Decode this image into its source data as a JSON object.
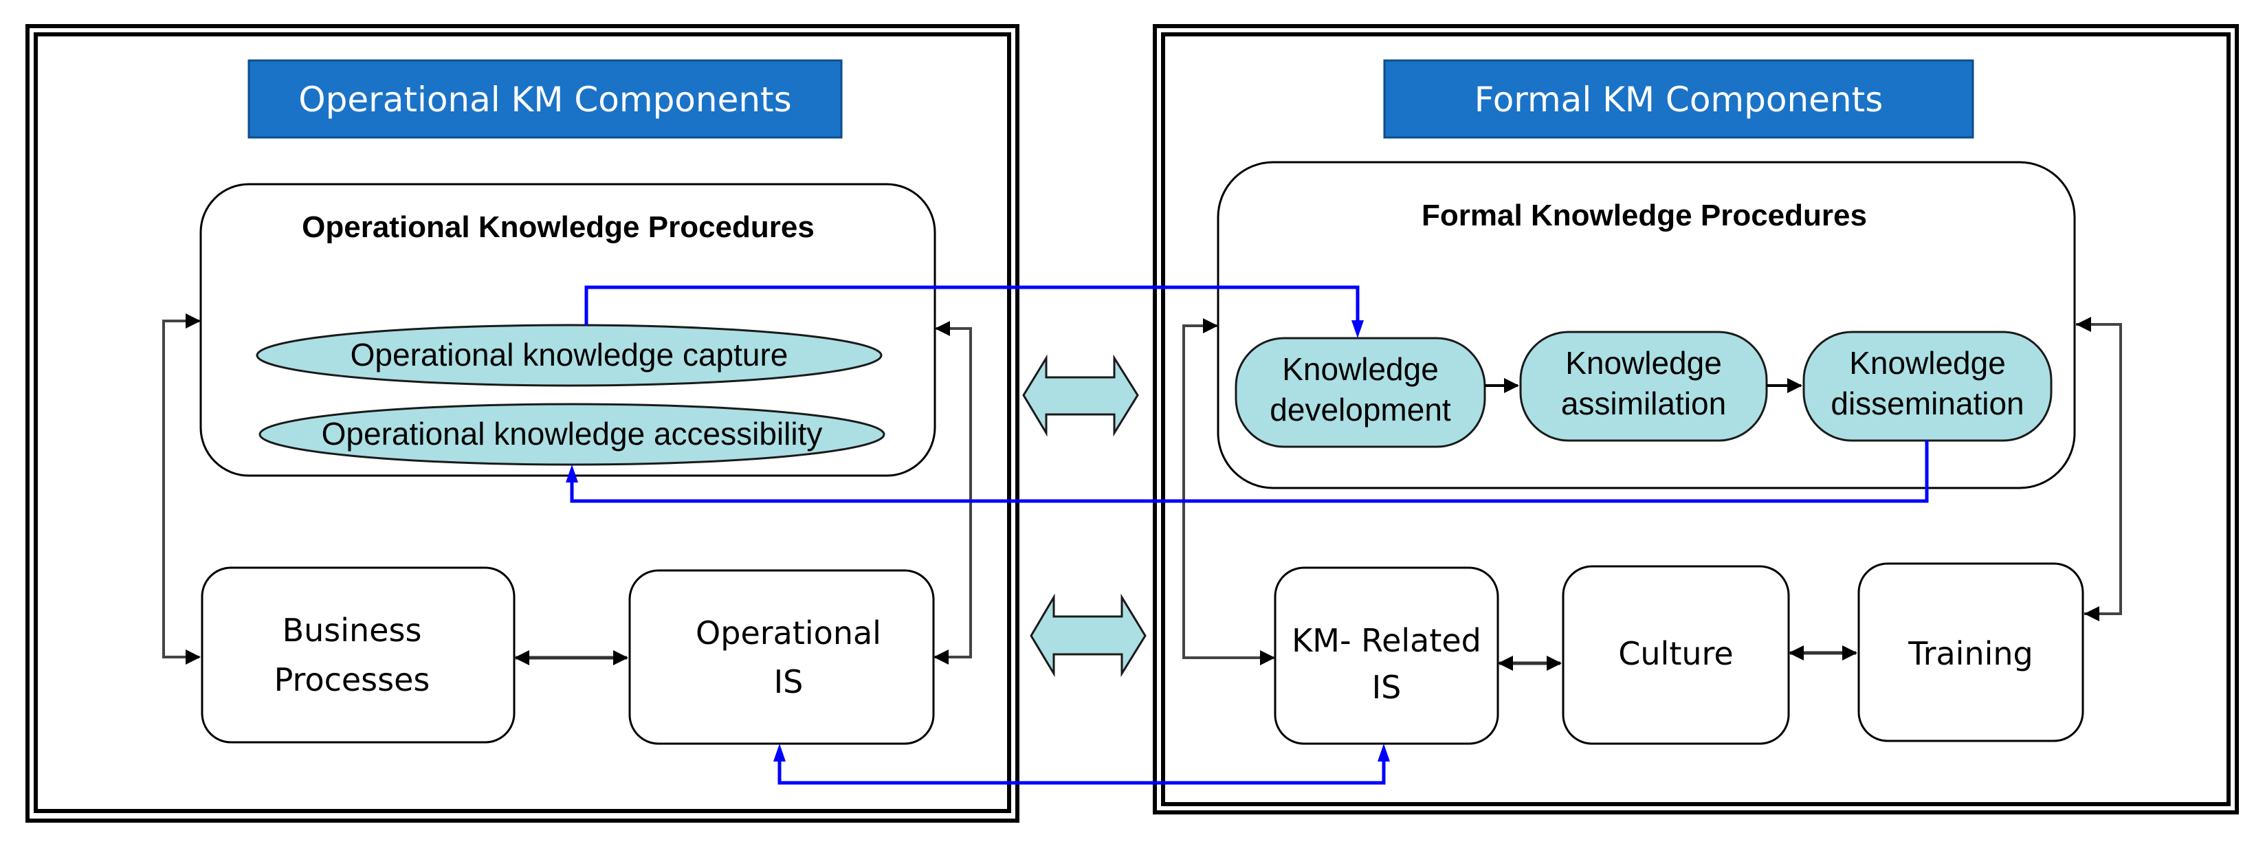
{
  "colors": {
    "banner_fill": "#1a73c7",
    "process_fill": "#abdfe3",
    "connector_blue": "#0000ff",
    "connector_gray": "#555555",
    "frame": "#000000"
  },
  "left_panel": {
    "banner": "Operational KM Components",
    "procedures_title": "Operational Knowledge Procedures",
    "procedures": [
      "Operational knowledge capture",
      "Operational knowledge accessibility"
    ],
    "boxes": [
      {
        "line1": "Business",
        "line2": "Processes"
      },
      {
        "line1": "Operational",
        "line2": "IS"
      }
    ]
  },
  "right_panel": {
    "banner": "Formal KM Components",
    "procedures_title": "Formal Knowledge Procedures",
    "procedures": [
      {
        "line1": "Knowledge",
        "line2": "development"
      },
      {
        "line1": "Knowledge",
        "line2": "assimilation"
      },
      {
        "line1": "Knowledge",
        "line2": "dissemination"
      }
    ],
    "boxes": [
      {
        "line1": "KM- Related",
        "line2": "IS"
      },
      {
        "line1": "Culture",
        "line2": ""
      },
      {
        "line1": "Training",
        "line2": ""
      }
    ]
  },
  "connections": [
    {
      "from": "Operational knowledge capture",
      "to": "Knowledge development",
      "style": "blue"
    },
    {
      "from": "Knowledge dissemination",
      "to": "Operational knowledge accessibility",
      "style": "blue"
    },
    {
      "from": "KM- Related IS",
      "to": "Operational IS",
      "style": "blue",
      "bidirectional": true
    },
    {
      "from": "Knowledge development",
      "to": "Knowledge assimilation",
      "style": "black"
    },
    {
      "from": "Knowledge assimilation",
      "to": "Knowledge dissemination",
      "style": "black"
    },
    {
      "from": "Business Processes",
      "to": "Operational IS",
      "style": "black",
      "bidirectional": true
    },
    {
      "from": "KM- Related IS",
      "to": "Culture",
      "style": "black",
      "bidirectional": true
    },
    {
      "from": "Culture",
      "to": "Training",
      "style": "black",
      "bidirectional": true
    },
    {
      "from": "Operational Knowledge Procedures",
      "to": "Business Processes",
      "style": "gray",
      "bidirectional": true
    },
    {
      "from": "Operational Knowledge Procedures",
      "to": "Operational IS",
      "style": "gray",
      "bidirectional": true
    },
    {
      "from": "Formal Knowledge Procedures",
      "to": "KM- Related IS",
      "style": "gray",
      "bidirectional": true
    },
    {
      "from": "Formal Knowledge Procedures",
      "to": "Training",
      "style": "gray",
      "bidirectional": true
    },
    {
      "from": "Operational KM Components",
      "to": "Formal KM Components",
      "style": "hollow",
      "bidirectional": true
    }
  ]
}
